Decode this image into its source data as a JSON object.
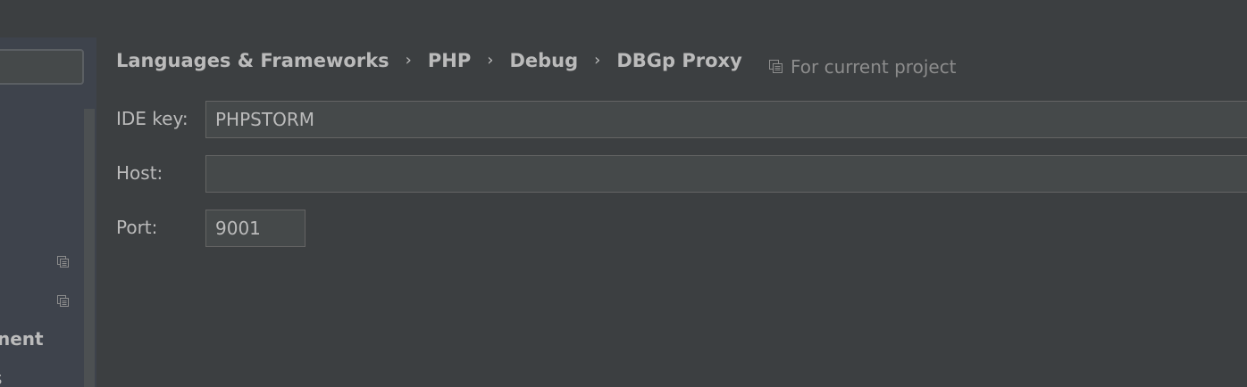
{
  "breadcrumb": {
    "items": [
      "Languages & Frameworks",
      "PHP",
      "Debug",
      "DBGp Proxy"
    ],
    "separator": "›"
  },
  "scope": {
    "label": "For current project",
    "icon": "copy-icon"
  },
  "form": {
    "ide_key": {
      "label": "IDE key:",
      "value": "PHPSTORM"
    },
    "host": {
      "label": "Host:",
      "value": ""
    },
    "port": {
      "label": "Port:",
      "value": "9001"
    }
  },
  "sidebar": {
    "visible_text_1": "nent",
    "visible_text_2": "s"
  },
  "colors": {
    "background": "#3c3f41",
    "sidebar": "#3e434c",
    "text": "#bbbbbb",
    "muted_text": "#8c8c8c",
    "field_bg": "#45494a",
    "field_border": "#646464"
  }
}
